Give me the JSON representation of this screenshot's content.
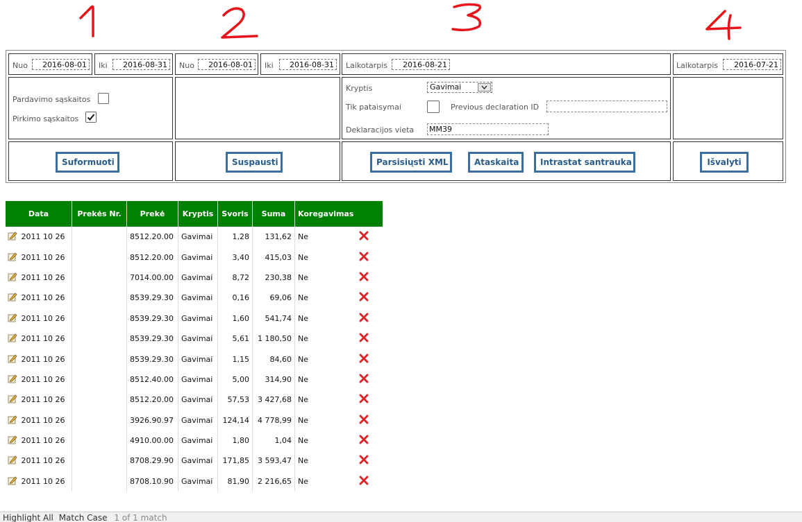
{
  "annotations": [
    "1",
    "2",
    "3",
    "4"
  ],
  "section1": {
    "from_label": "Nuo",
    "from_value": "2016-08-01",
    "to_label": "Iki",
    "to_value": "2016-08-31",
    "sales_label": "Pardavimo sąskaitos",
    "sales_checked": false,
    "purchase_label": "Pirkimo sąskaitos",
    "purchase_checked": true,
    "button": "Suformuoti"
  },
  "section2": {
    "from_label": "Nuo",
    "from_value": "2016-08-01",
    "to_label": "Iki",
    "to_value": "2016-08-31",
    "button": "Suspausti"
  },
  "section3": {
    "period_label": "Laikotarpis",
    "period_value": "2016-08-21",
    "direction_label": "Kryptis",
    "direction_value": "Gavimai",
    "corrections_label": "Tik pataisymai",
    "corrections_checked": false,
    "prev_decl_label": "Previous declaration ID",
    "prev_decl_value": "",
    "location_label": "Deklaracijos vieta",
    "location_value": "MM39",
    "btn_xml": "Parsisiųsti XML",
    "btn_report": "Ataskaita",
    "btn_summary": "Intrastat santrauka"
  },
  "section4": {
    "period_label": "Laikotarpis",
    "period_value": "2016-07-21",
    "button": "Išvalyti"
  },
  "table": {
    "headers": [
      "Data",
      "Prekės Nr.",
      "Prekė",
      "Kryptis",
      "Svoris",
      "Suma",
      "Koregavimas"
    ],
    "rows": [
      [
        "2011 10 26",
        "",
        "8512.20.00",
        "Gavimai",
        "1,28",
        "131,62",
        "Ne"
      ],
      [
        "2011 10 26",
        "",
        "8512.20.00",
        "Gavimai",
        "3,40",
        "415,03",
        "Ne"
      ],
      [
        "2011 10 26",
        "",
        "7014.00.00",
        "Gavimai",
        "8,72",
        "230,38",
        "Ne"
      ],
      [
        "2011 10 26",
        "",
        "8539.29.30",
        "Gavimai",
        "0,16",
        "69,06",
        "Ne"
      ],
      [
        "2011 10 26",
        "",
        "8539.29.30",
        "Gavimai",
        "1,60",
        "541,74",
        "Ne"
      ],
      [
        "2011 10 26",
        "",
        "8539.29.30",
        "Gavimai",
        "5,61",
        "1 180,50",
        "Ne"
      ],
      [
        "2011 10 26",
        "",
        "8539.29.30",
        "Gavimai",
        "1,15",
        "84,60",
        "Ne"
      ],
      [
        "2011 10 26",
        "",
        "8512.40.00",
        "Gavimai",
        "5,00",
        "314,90",
        "Ne"
      ],
      [
        "2011 10 26",
        "",
        "8512.20.00",
        "Gavimai",
        "57,53",
        "3 427,68",
        "Ne"
      ],
      [
        "2011 10 26",
        "",
        "3926.90.97",
        "Gavimai",
        "124,14",
        "4 778,99",
        "Ne"
      ],
      [
        "2011 10 26",
        "",
        "4910.00.00",
        "Gavimai",
        "1,80",
        "1,04",
        "Ne"
      ],
      [
        "2011 10 26",
        "",
        "8708.29.90",
        "Gavimai",
        "171,85",
        "3 593,47",
        "Ne"
      ],
      [
        "2011 10 26",
        "",
        "8708.10.90",
        "Gavimai",
        "81,90",
        "2 216,65",
        "Ne"
      ]
    ]
  },
  "statusbar": {
    "text": "Highlight All",
    "match_case": "Match Case",
    "count": "1 of 1 match"
  },
  "colors": {
    "header_green": "#008000",
    "button_border": "#3a6e9e",
    "annotation_red": "#e8141b",
    "delete_red": "#d8262b"
  },
  "icons": [
    "pencil-edit-icon",
    "delete-x-icon",
    "checkmark-icon",
    "dropdown-arrow-icon"
  ]
}
